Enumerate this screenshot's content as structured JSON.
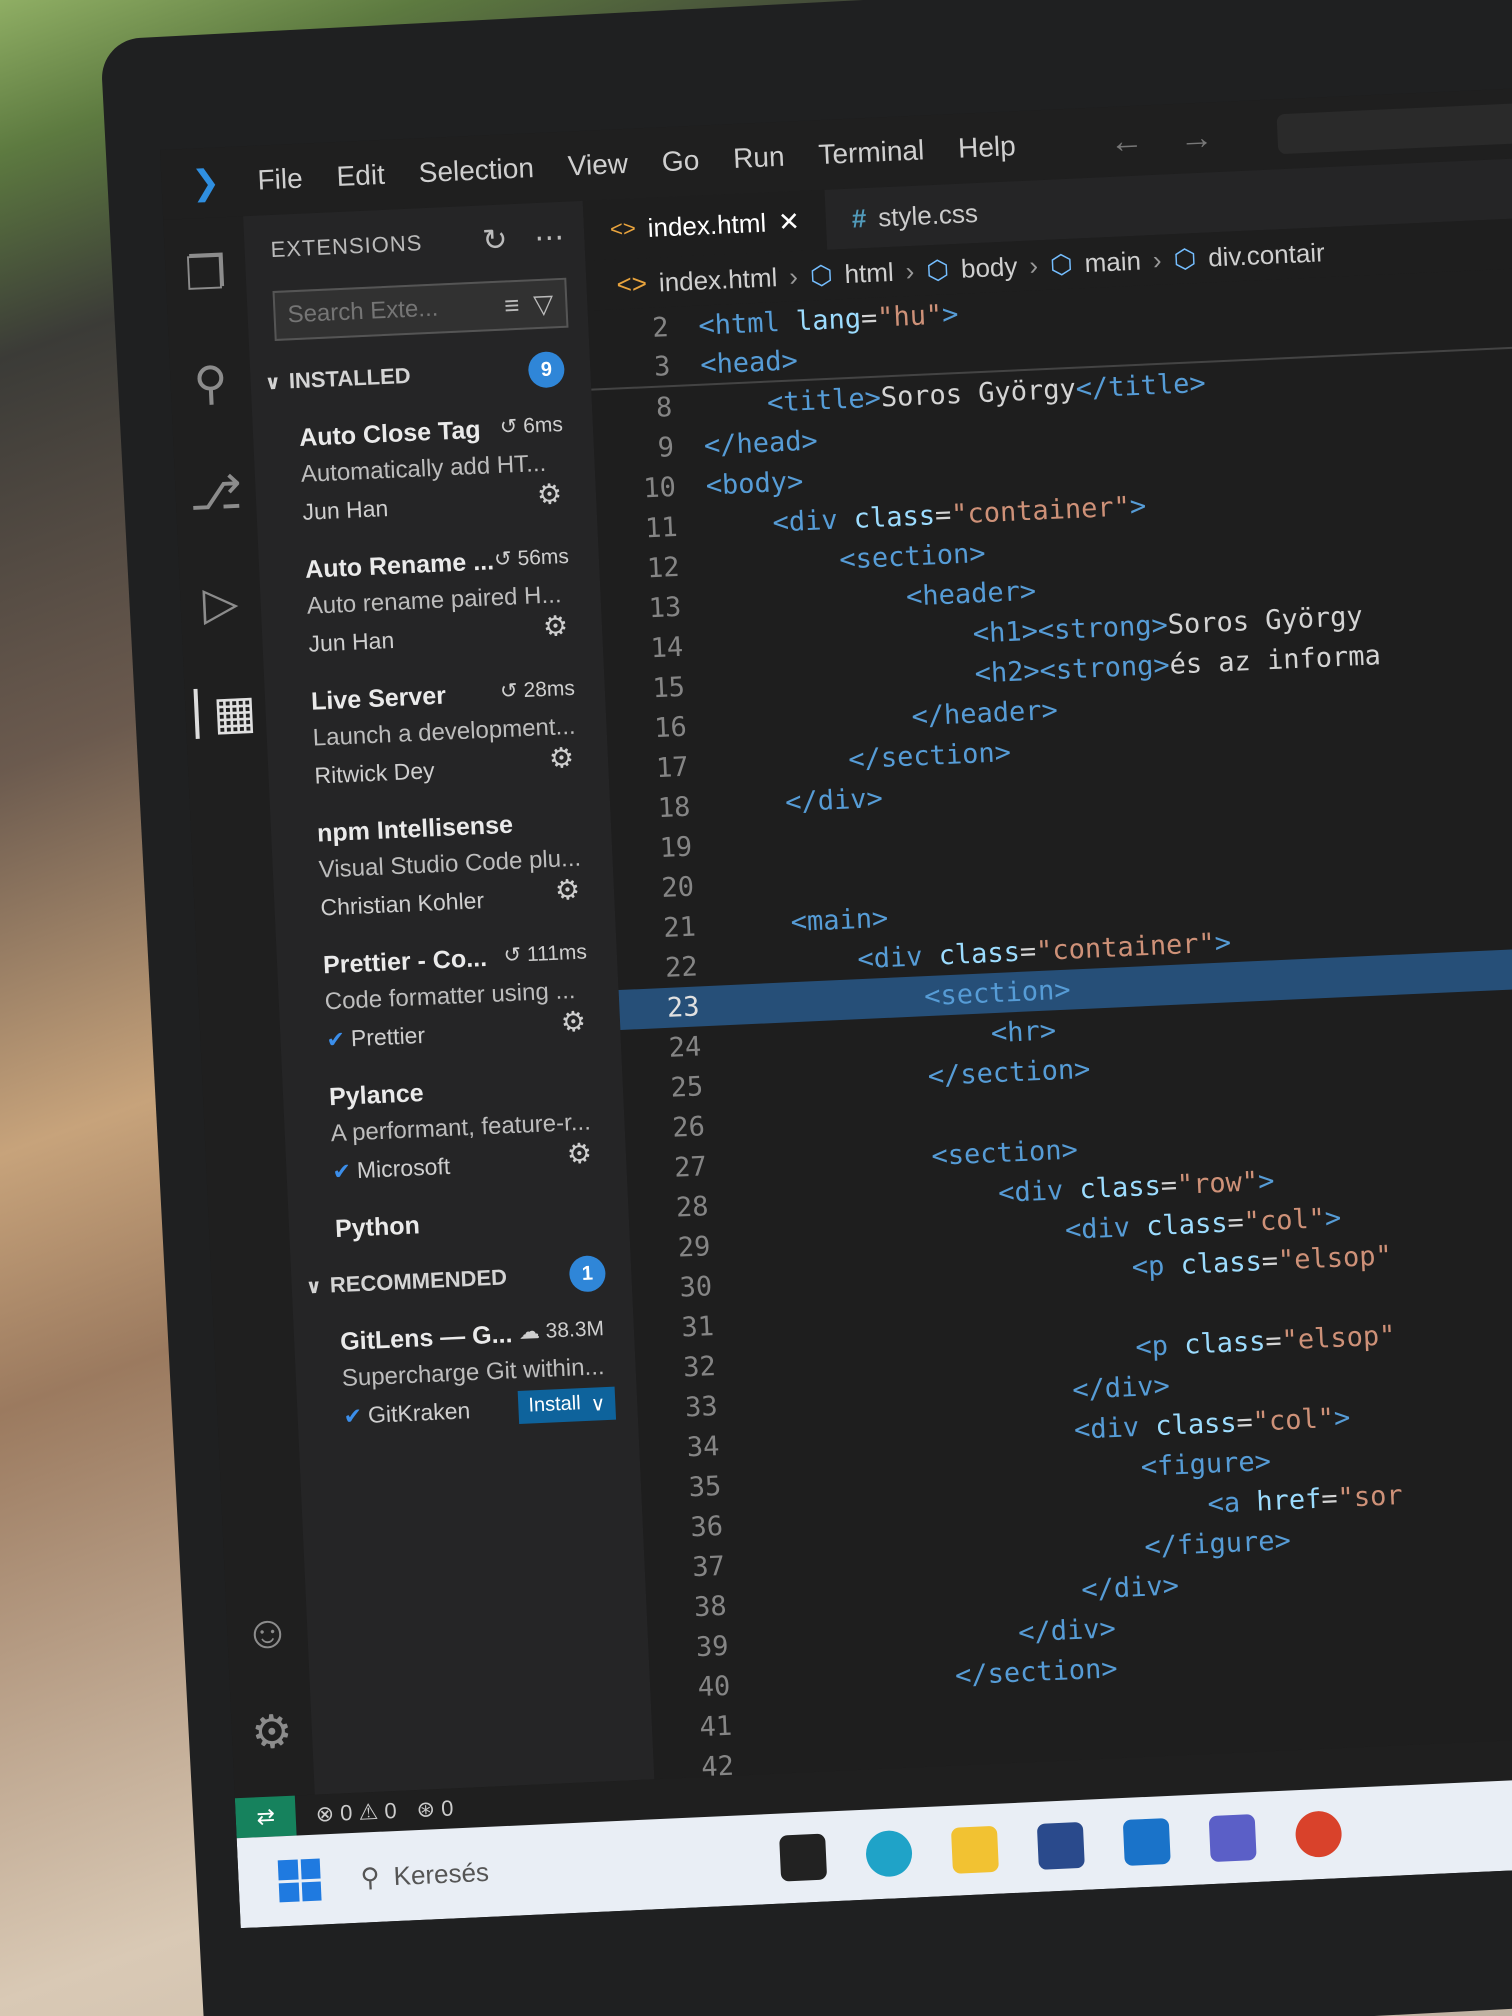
{
  "menubar": {
    "items": [
      "File",
      "Edit",
      "Selection",
      "View",
      "Go",
      "Run",
      "Terminal",
      "Help"
    ]
  },
  "sidebar": {
    "title": "EXTENSIONS",
    "search_placeholder": "Search Exte...",
    "installed": {
      "label": "INSTALLED",
      "count": "9",
      "items": [
        {
          "name": "Auto Close Tag",
          "time": "6ms",
          "desc": "Automatically add HT...",
          "publisher": "Jun Han",
          "verified": false
        },
        {
          "name": "Auto Rename ...",
          "time": "56ms",
          "desc": "Auto rename paired H...",
          "publisher": "Jun Han",
          "verified": false
        },
        {
          "name": "Live Server",
          "time": "28ms",
          "desc": "Launch a development...",
          "publisher": "Ritwick Dey",
          "verified": false
        },
        {
          "name": "npm Intellisense",
          "time": "",
          "desc": "Visual Studio Code plu...",
          "publisher": "Christian Kohler",
          "verified": false
        },
        {
          "name": "Prettier - Co...",
          "time": "111ms",
          "desc": "Code formatter using ...",
          "publisher": "Prettier",
          "verified": true
        },
        {
          "name": "Pylance",
          "time": "",
          "desc": "A performant, feature-r...",
          "publisher": "Microsoft",
          "verified": true
        },
        {
          "name": "Python",
          "time": "",
          "desc": "",
          "publisher": "",
          "verified": false
        }
      ]
    },
    "recommended": {
      "label": "RECOMMENDED",
      "count": "1",
      "items": [
        {
          "name": "GitLens — G...",
          "downloads": "38.3M",
          "desc": "Supercharge Git within...",
          "publisher": "GitKraken",
          "install_label": "Install"
        }
      ]
    }
  },
  "tabs": [
    {
      "label": "index.html",
      "active": true
    },
    {
      "label": "style.css",
      "active": false
    }
  ],
  "breadcrumb": [
    "index.html",
    "html",
    "body",
    "main",
    "div.contair"
  ],
  "code_lines": [
    {
      "n": "2",
      "t": [
        [
          "tg",
          "<html "
        ],
        [
          "at",
          "lang"
        ],
        [
          "tx",
          "="
        ],
        [
          "st",
          "\"hu\""
        ],
        [
          "tg",
          ">"
        ]
      ]
    },
    {
      "n": "3",
      "t": [
        [
          "tg",
          "<head>"
        ]
      ]
    },
    {
      "n": "8",
      "t": [
        [
          "tx",
          "    "
        ],
        [
          "tg",
          "<title>"
        ],
        [
          "tx",
          "Soros György"
        ],
        [
          "tg",
          "</title>"
        ]
      ]
    },
    {
      "n": "9",
      "t": [
        [
          "tg",
          "</head>"
        ]
      ]
    },
    {
      "n": "10",
      "t": [
        [
          "tg",
          "<body>"
        ]
      ]
    },
    {
      "n": "11",
      "t": [
        [
          "tx",
          "    "
        ],
        [
          "tg",
          "<div "
        ],
        [
          "at",
          "class"
        ],
        [
          "tx",
          "="
        ],
        [
          "st",
          "\"container\""
        ],
        [
          "tg",
          ">"
        ]
      ]
    },
    {
      "n": "12",
      "t": [
        [
          "tx",
          "        "
        ],
        [
          "tg",
          "<section>"
        ]
      ]
    },
    {
      "n": "13",
      "t": [
        [
          "tx",
          "            "
        ],
        [
          "tg",
          "<header>"
        ]
      ]
    },
    {
      "n": "14",
      "t": [
        [
          "tx",
          "                "
        ],
        [
          "tg",
          "<h1><strong>"
        ],
        [
          "tx",
          "Soros György"
        ]
      ]
    },
    {
      "n": "15",
      "t": [
        [
          "tx",
          "                "
        ],
        [
          "tg",
          "<h2><strong>"
        ],
        [
          "tx",
          "és az informa"
        ]
      ]
    },
    {
      "n": "16",
      "t": [
        [
          "tx",
          "            "
        ],
        [
          "tg",
          "</header>"
        ]
      ]
    },
    {
      "n": "17",
      "t": [
        [
          "tx",
          "        "
        ],
        [
          "tg",
          "</section>"
        ]
      ]
    },
    {
      "n": "18",
      "t": [
        [
          "tx",
          "    "
        ],
        [
          "tg",
          "</div>"
        ]
      ]
    },
    {
      "n": "19",
      "t": []
    },
    {
      "n": "20",
      "t": []
    },
    {
      "n": "21",
      "t": [
        [
          "tx",
          "    "
        ],
        [
          "tg",
          "<main>"
        ]
      ]
    },
    {
      "n": "22",
      "t": [
        [
          "tx",
          "        "
        ],
        [
          "tg",
          "<div "
        ],
        [
          "at",
          "class"
        ],
        [
          "tx",
          "="
        ],
        [
          "st",
          "\"container\""
        ],
        [
          "tg",
          ">"
        ]
      ]
    },
    {
      "n": "23",
      "t": [
        [
          "tx",
          "            "
        ],
        [
          "tg",
          "<section>"
        ]
      ],
      "hl": true
    },
    {
      "n": "24",
      "t": [
        [
          "tx",
          "                "
        ],
        [
          "tg",
          "<hr>"
        ]
      ]
    },
    {
      "n": "25",
      "t": [
        [
          "tx",
          "            "
        ],
        [
          "tg",
          "</section>"
        ]
      ]
    },
    {
      "n": "26",
      "t": []
    },
    {
      "n": "27",
      "t": [
        [
          "tx",
          "            "
        ],
        [
          "tg",
          "<section>"
        ]
      ]
    },
    {
      "n": "28",
      "t": [
        [
          "tx",
          "                "
        ],
        [
          "tg",
          "<div "
        ],
        [
          "at",
          "class"
        ],
        [
          "tx",
          "="
        ],
        [
          "st",
          "\"row\""
        ],
        [
          "tg",
          ">"
        ]
      ]
    },
    {
      "n": "29",
      "t": [
        [
          "tx",
          "                    "
        ],
        [
          "tg",
          "<div "
        ],
        [
          "at",
          "class"
        ],
        [
          "tx",
          "="
        ],
        [
          "st",
          "\"col\""
        ],
        [
          "tg",
          ">"
        ]
      ]
    },
    {
      "n": "30",
      "t": [
        [
          "tx",
          "                        "
        ],
        [
          "tg",
          "<p "
        ],
        [
          "at",
          "class"
        ],
        [
          "tx",
          "="
        ],
        [
          "st",
          "\"elsop\""
        ]
      ]
    },
    {
      "n": "31",
      "t": []
    },
    {
      "n": "32",
      "t": [
        [
          "tx",
          "                        "
        ],
        [
          "tg",
          "<p "
        ],
        [
          "at",
          "class"
        ],
        [
          "tx",
          "="
        ],
        [
          "st",
          "\"elsop\""
        ]
      ]
    },
    {
      "n": "33",
      "t": [
        [
          "tx",
          "                    "
        ],
        [
          "tg",
          "</div>"
        ]
      ]
    },
    {
      "n": "34",
      "t": [
        [
          "tx",
          "                    "
        ],
        [
          "tg",
          "<div "
        ],
        [
          "at",
          "class"
        ],
        [
          "tx",
          "="
        ],
        [
          "st",
          "\"col\""
        ],
        [
          "tg",
          ">"
        ]
      ]
    },
    {
      "n": "35",
      "t": [
        [
          "tx",
          "                        "
        ],
        [
          "tg",
          "<figure>"
        ]
      ]
    },
    {
      "n": "36",
      "t": [
        [
          "tx",
          "                            "
        ],
        [
          "tg",
          "<a "
        ],
        [
          "at",
          "href"
        ],
        [
          "tx",
          "="
        ],
        [
          "st",
          "\"sor"
        ]
      ]
    },
    {
      "n": "37",
      "t": [
        [
          "tx",
          "                        "
        ],
        [
          "tg",
          "</figure>"
        ]
      ]
    },
    {
      "n": "38",
      "t": [
        [
          "tx",
          "                    "
        ],
        [
          "tg",
          "</div>"
        ]
      ]
    },
    {
      "n": "39",
      "t": [
        [
          "tx",
          "                "
        ],
        [
          "tg",
          "</div>"
        ]
      ]
    },
    {
      "n": "40",
      "t": [
        [
          "tx",
          "            "
        ],
        [
          "tg",
          "</section>"
        ]
      ]
    },
    {
      "n": "41",
      "t": []
    },
    {
      "n": "42",
      "t": []
    }
  ],
  "statusbar": {
    "errors": "0",
    "warnings": "0",
    "ports": "0"
  },
  "taskbar": {
    "search_placeholder": "Keresés"
  }
}
